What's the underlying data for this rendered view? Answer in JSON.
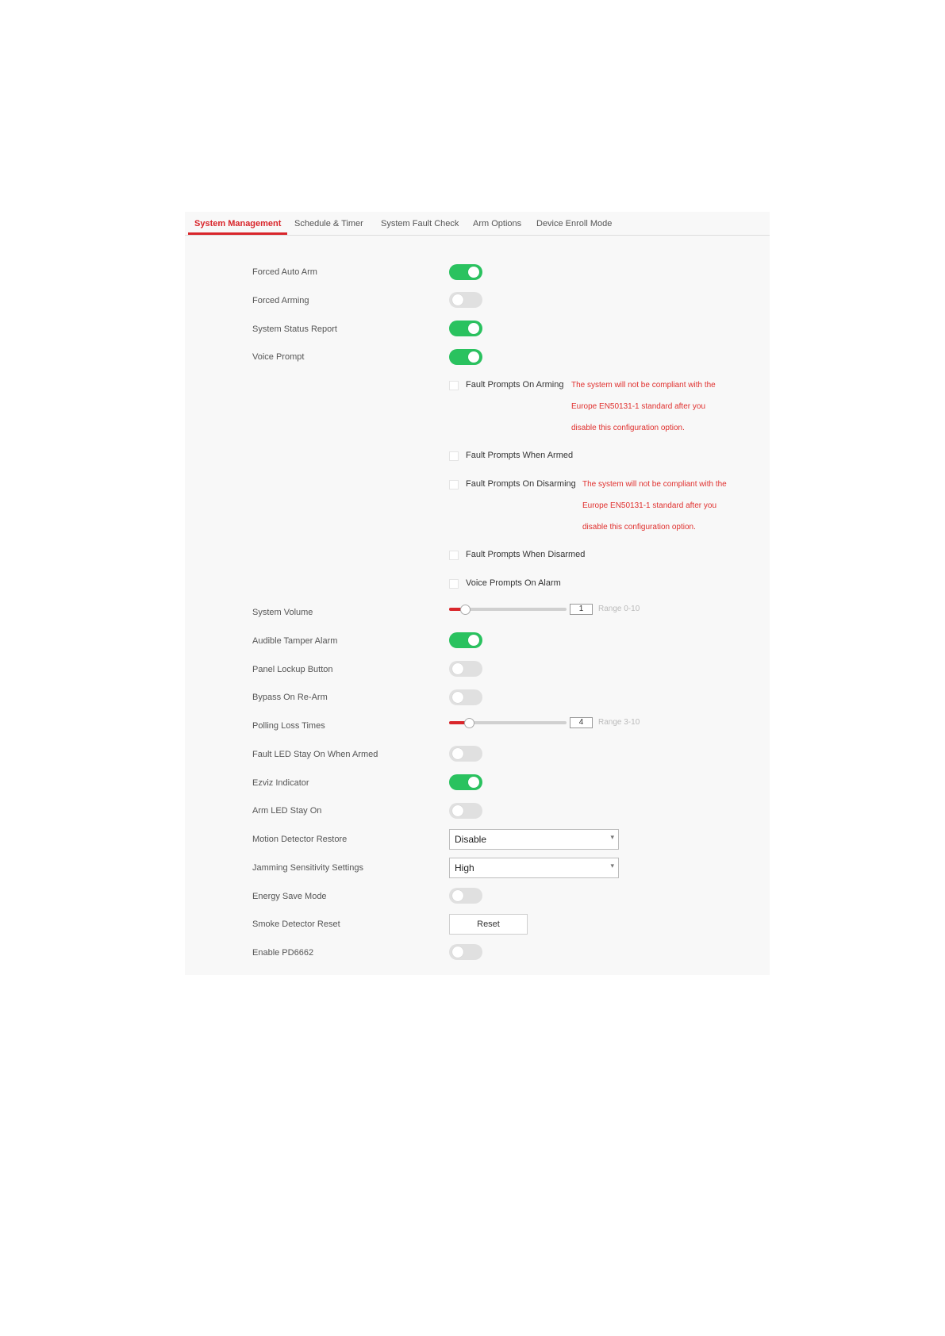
{
  "tabs": [
    {
      "label": "System Management"
    },
    {
      "label": "Schedule & Timer"
    },
    {
      "label": "System Fault Check"
    },
    {
      "label": "Arm Options"
    },
    {
      "label": "Device Enroll Mode"
    }
  ],
  "settings": {
    "forced_auto_arm": {
      "label": "Forced Auto Arm",
      "state": "on"
    },
    "forced_arming": {
      "label": "Forced Arming",
      "state": "off"
    },
    "system_status_report": {
      "label": "System Status Report",
      "state": "on"
    },
    "voice_prompt": {
      "label": "Voice Prompt",
      "state": "on"
    },
    "system_volume": {
      "label": "System Volume",
      "value": "1",
      "range": "Range 0-10",
      "fraction": 0.1
    },
    "audible_tamper_alarm": {
      "label": "Audible Tamper Alarm",
      "state": "on"
    },
    "panel_lockup_button": {
      "label": "Panel Lockup Button",
      "state": "off"
    },
    "bypass_on_rearm": {
      "label": "Bypass On Re-Arm",
      "state": "off"
    },
    "polling_loss_times": {
      "label": "Polling Loss Times",
      "value": "4",
      "range": "Range 3-10",
      "fraction": 0.143
    },
    "fault_led_stay_on": {
      "label": "Fault LED Stay On When Armed",
      "state": "off"
    },
    "ezviz_indicator": {
      "label": "Ezviz Indicator",
      "state": "on"
    },
    "arm_led_stay_on": {
      "label": "Arm LED Stay On",
      "state": "off"
    },
    "motion_detector_restore": {
      "label": "Motion Detector Restore",
      "value": "Disable"
    },
    "jamming_sensitivity": {
      "label": "Jamming Sensitivity Settings",
      "value": "High"
    },
    "energy_save_mode": {
      "label": "Energy Save Mode",
      "state": "off"
    },
    "smoke_detector_reset": {
      "label": "Smoke Detector Reset",
      "button": "Reset"
    },
    "enable_pd6662": {
      "label": "Enable PD6662",
      "state": "off"
    }
  },
  "voice_options": [
    {
      "label": "Fault Prompts On Arming",
      "checked": false,
      "warning": [
        "The system will not be compliant with the",
        "Europe EN50131-1 standard after you",
        "disable this configuration option."
      ]
    },
    {
      "label": "Fault Prompts When Armed",
      "checked": false
    },
    {
      "label": "Fault Prompts On Disarming",
      "checked": false,
      "warning": [
        "The system will not be compliant with the",
        "Europe EN50131-1 standard after you",
        "disable this configuration option."
      ]
    },
    {
      "label": "Fault Prompts When Disarmed",
      "checked": false
    },
    {
      "label": "Voice Prompts On Alarm",
      "checked": false
    }
  ],
  "colors": {
    "accent": "#d9262b",
    "toggle_on": "#2ac25f",
    "toggle_off": "#e0e0e0",
    "warning": "#e0302e"
  }
}
